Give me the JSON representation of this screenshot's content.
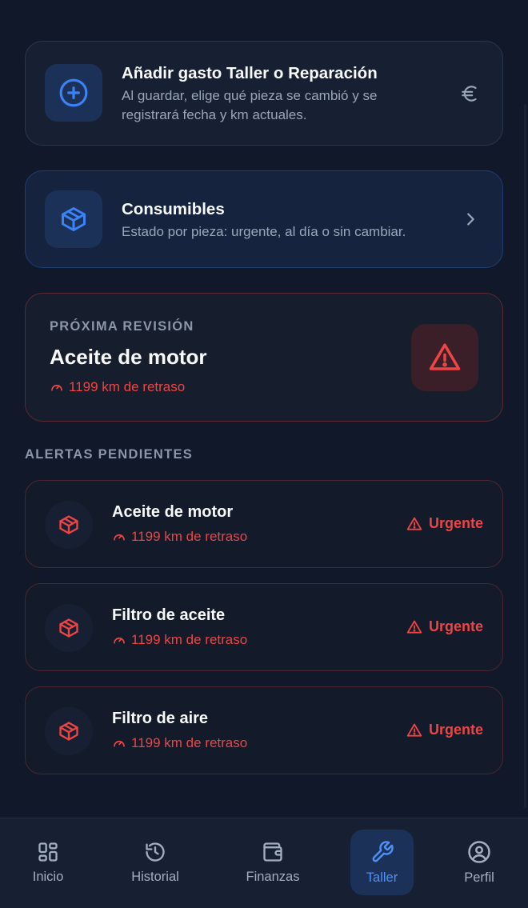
{
  "add_expense": {
    "title": "Añadir gasto Taller o Reparación",
    "subtitle_line1": "Al guardar, elige qué pieza se cambió y se",
    "subtitle_line2": "registrará fecha y km actuales.",
    "icon": "plus-circle-icon",
    "right_icon": "euro-icon"
  },
  "consumables": {
    "title": "Consumibles",
    "subtitle": "Estado por pieza: urgente, al día o sin cambiar.",
    "icon": "box-icon",
    "right_icon": "chevron-right-icon"
  },
  "next_revision": {
    "eyebrow": "PRÓXIMA REVISIÓN",
    "title": "Aceite de motor",
    "delay": "1199 km de retraso",
    "icon": "warning-triangle-icon"
  },
  "alerts_section_label": "ALERTAS PENDIENTES",
  "alerts": [
    {
      "name": "Aceite de motor",
      "delay": "1199 km de retraso",
      "status": "Urgente"
    },
    {
      "name": "Filtro de aceite",
      "delay": "1199 km de retraso",
      "status": "Urgente"
    },
    {
      "name": "Filtro de aire",
      "delay": "1199 km de retraso",
      "status": "Urgente"
    }
  ],
  "tabs": [
    {
      "label": "Inicio",
      "icon": "grid-icon",
      "active": false
    },
    {
      "label": "Historial",
      "icon": "history-icon",
      "active": false
    },
    {
      "label": "Finanzas",
      "icon": "wallet-icon",
      "active": false
    },
    {
      "label": "Taller",
      "icon": "wrench-icon",
      "active": true
    },
    {
      "label": "Perfil",
      "icon": "user-circle-icon",
      "active": false
    }
  ],
  "colors": {
    "accent": "#4f8ff7",
    "danger": "#ef4444",
    "background": "#111829"
  }
}
